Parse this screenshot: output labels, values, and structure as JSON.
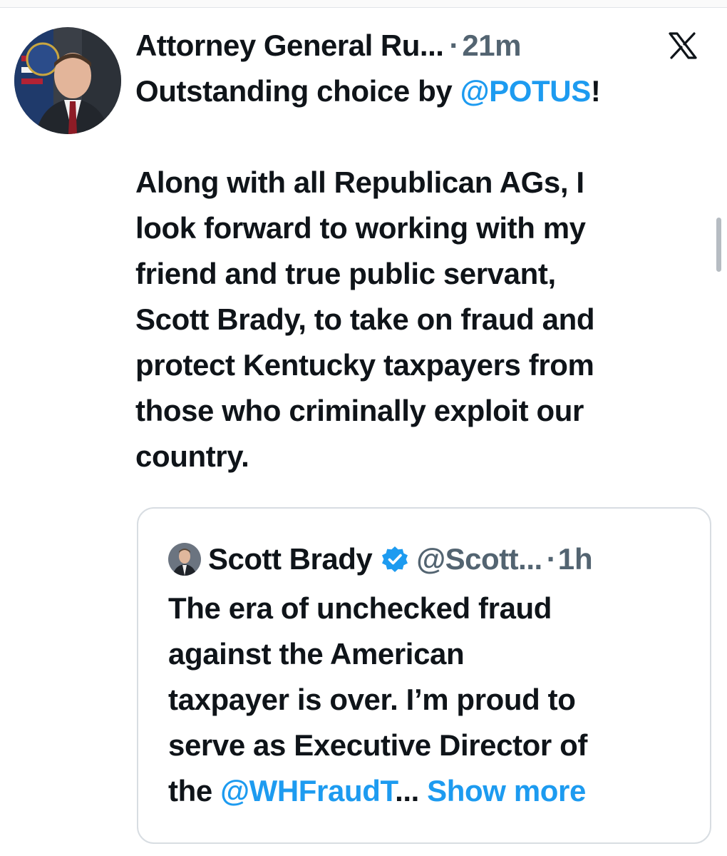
{
  "tweet": {
    "author_name": "Attorney General Ru...",
    "separator": "·",
    "timestamp": "21m",
    "body": {
      "line1_prefix": "Outstanding choice by ",
      "line1_mention": "@POTUS",
      "line1_suffix": "!",
      "para2_lines": [
        "Along with all Republican AGs, I",
        "look forward to working with my",
        "friend and true public servant,",
        "Scott Brady, to take on fraud and",
        "protect Kentucky taxpayers from",
        "those who criminally exploit our",
        "country."
      ]
    }
  },
  "quoted_tweet": {
    "author_name": "Scott Brady",
    "handle": "@Scott...",
    "separator": "·",
    "timestamp": "1h",
    "lines": [
      "The era of unchecked fraud",
      "against the American",
      "taxpayer is over. I’m proud to",
      "serve as Executive Director of"
    ],
    "last_line_prefix": "the ",
    "last_line_mention": "@WHFraudT",
    "last_line_ellipsis": "... ",
    "show_more_label": "Show more"
  },
  "icons": {
    "platform": "x-logo-icon",
    "verified": "verified-badge-icon"
  },
  "colors": {
    "link": "#1d9bf0",
    "text": "#0f1419",
    "secondary": "#536471",
    "border": "#d8dde2"
  }
}
